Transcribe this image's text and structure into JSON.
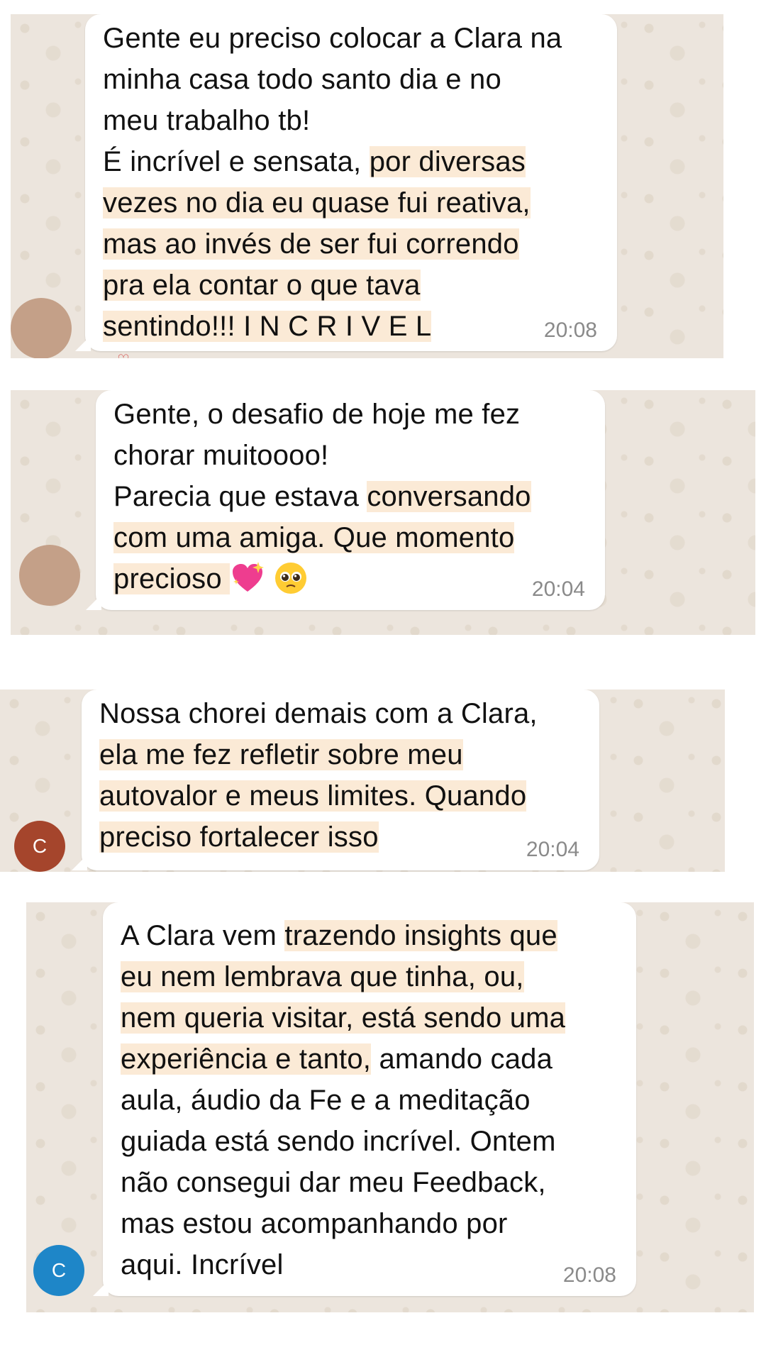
{
  "colors": {
    "highlight": "#fbead6",
    "bubble": "#ffffff",
    "wallpaper": "#ece5dd",
    "avatar_photo": "#c4a088",
    "avatar_c_brown": "#a5452c",
    "avatar_c_blue": "#1e86c8"
  },
  "messages": [
    {
      "lines": [
        [
          {
            "t": "Gente eu preciso colocar a Clara na",
            "h": false
          }
        ],
        [
          {
            "t": "minha casa todo santo dia e no",
            "h": false
          }
        ],
        [
          {
            "t": "meu trabalho tb!",
            "h": false
          }
        ],
        [
          {
            "t": "É incrível e sensata, ",
            "h": false
          },
          {
            "t": "por diversas ",
            "h": true
          }
        ],
        [
          {
            "t": "vezes no dia eu quase fui reativa, ",
            "h": true
          }
        ],
        [
          {
            "t": "mas ao invés de ser fui correndo ",
            "h": true
          }
        ],
        [
          {
            "t": "pra ela contar o que tava",
            "h": true
          }
        ],
        [
          {
            "t": "sentindo!!! I N C R I V E L",
            "h": true
          }
        ]
      ],
      "time": "20:08",
      "avatar_label": "",
      "avatar_icon": "user-photo-avatar"
    },
    {
      "lines": [
        [
          {
            "t": "Gente, o desafio de hoje me fez",
            "h": false
          }
        ],
        [
          {
            "t": "chorar muitoooo!",
            "h": false
          }
        ],
        [
          {
            "t": "Parecia que estava ",
            "h": false
          },
          {
            "t": "conversando",
            "h": true
          }
        ],
        [
          {
            "t": "com uma amiga. Que momento",
            "h": true
          }
        ],
        [
          {
            "t": "precioso ",
            "h": true
          }
        ]
      ],
      "emojis": [
        "sparkling-heart-icon",
        "pleading-face-icon"
      ],
      "time": "20:04",
      "avatar_label": "",
      "avatar_icon": "user-photo-avatar"
    },
    {
      "lines": [
        [
          {
            "t": "Nossa chorei demais com a Clara,",
            "h": false
          }
        ],
        [
          {
            "t": "ela me fez refletir sobre meu ",
            "h": true
          }
        ],
        [
          {
            "t": "autovalor e meus limites. Quando",
            "h": true
          }
        ],
        [
          {
            "t": "preciso fortalecer isso",
            "h": true
          }
        ]
      ],
      "time": "20:04",
      "avatar_label": "C",
      "avatar_icon": "letter-avatar"
    },
    {
      "lines": [
        [
          {
            "t": "A Clara vem ",
            "h": false
          },
          {
            "t": "trazendo insights que",
            "h": true
          }
        ],
        [
          {
            "t": "eu nem lembrava que tinha, ou,",
            "h": true
          }
        ],
        [
          {
            "t": "nem queria visitar, está sendo uma",
            "h": true
          }
        ],
        [
          {
            "t": "experiência e tanto,",
            "h": true
          },
          {
            "t": " amando cada",
            "h": false
          }
        ],
        [
          {
            "t": "aula, áudio da Fe e a meditação",
            "h": false
          }
        ],
        [
          {
            "t": "guiada está sendo incrível. Ontem",
            "h": false
          }
        ],
        [
          {
            "t": "não consegui dar meu Feedback,",
            "h": false
          }
        ],
        [
          {
            "t": "mas estou acompanhando por",
            "h": false
          }
        ],
        [
          {
            "t": "aqui. Incrível",
            "h": false
          }
        ]
      ],
      "time": "20:08",
      "avatar_label": "C",
      "avatar_icon": "letter-avatar"
    }
  ]
}
